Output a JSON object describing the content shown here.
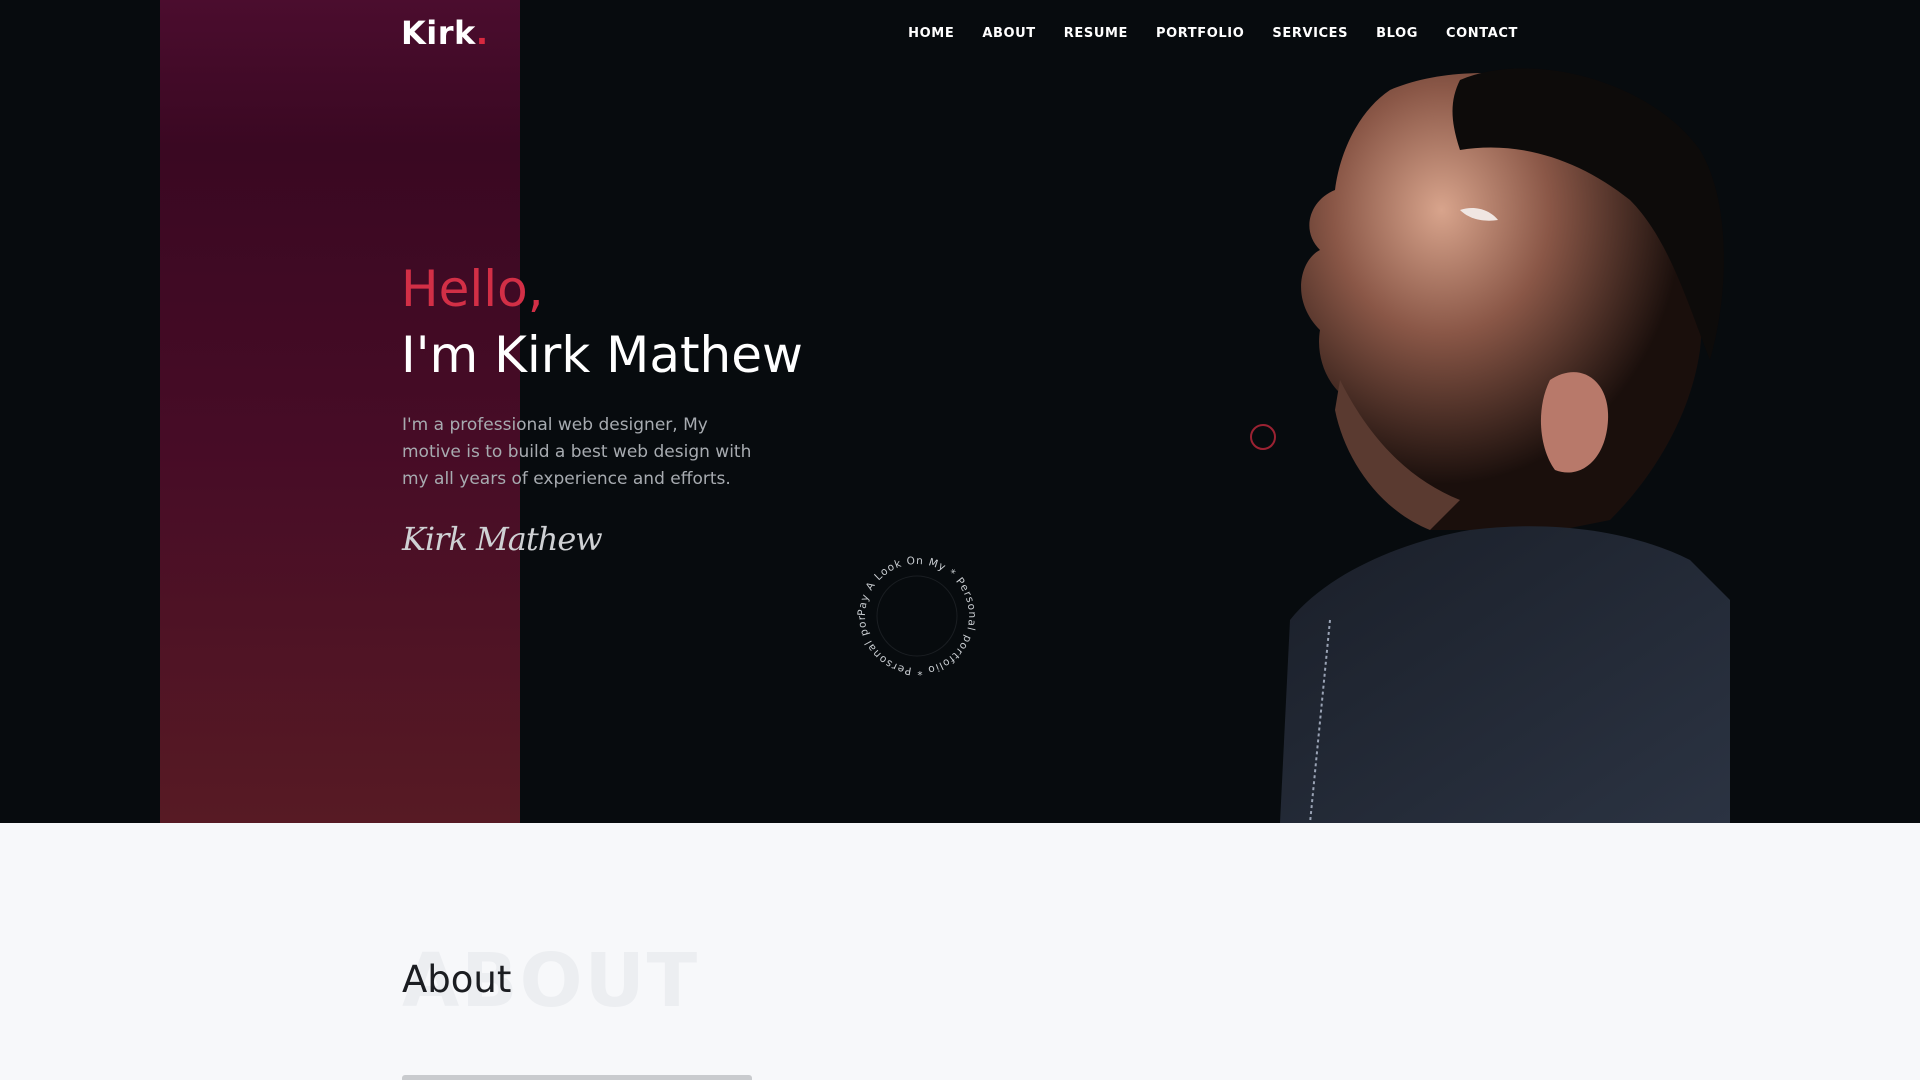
{
  "brand": {
    "name": "Kirk",
    "dot": ".",
    "accent_color": "#d8293f"
  },
  "nav": {
    "items": [
      {
        "label": "HOME"
      },
      {
        "label": "ABOUT"
      },
      {
        "label": "RESUME"
      },
      {
        "label": "PORTFOLIO"
      },
      {
        "label": "SERVICES"
      },
      {
        "label": "BLOG"
      },
      {
        "label": "CONTACT"
      }
    ]
  },
  "hero": {
    "greeting": "Hello,",
    "title": "I'm Kirk Mathew",
    "description": "I'm a professional web designer, My motive is to build a best web design with my all years of experience and efforts.",
    "signature": "Kirk Mathew",
    "circle_text": "Pay A Look On My * Personal portfolio * Personal portfolio *",
    "background_color": "#070b0e",
    "band_color": "#4b0d2e"
  },
  "about": {
    "watermark": "ABOUT",
    "title": "About"
  }
}
